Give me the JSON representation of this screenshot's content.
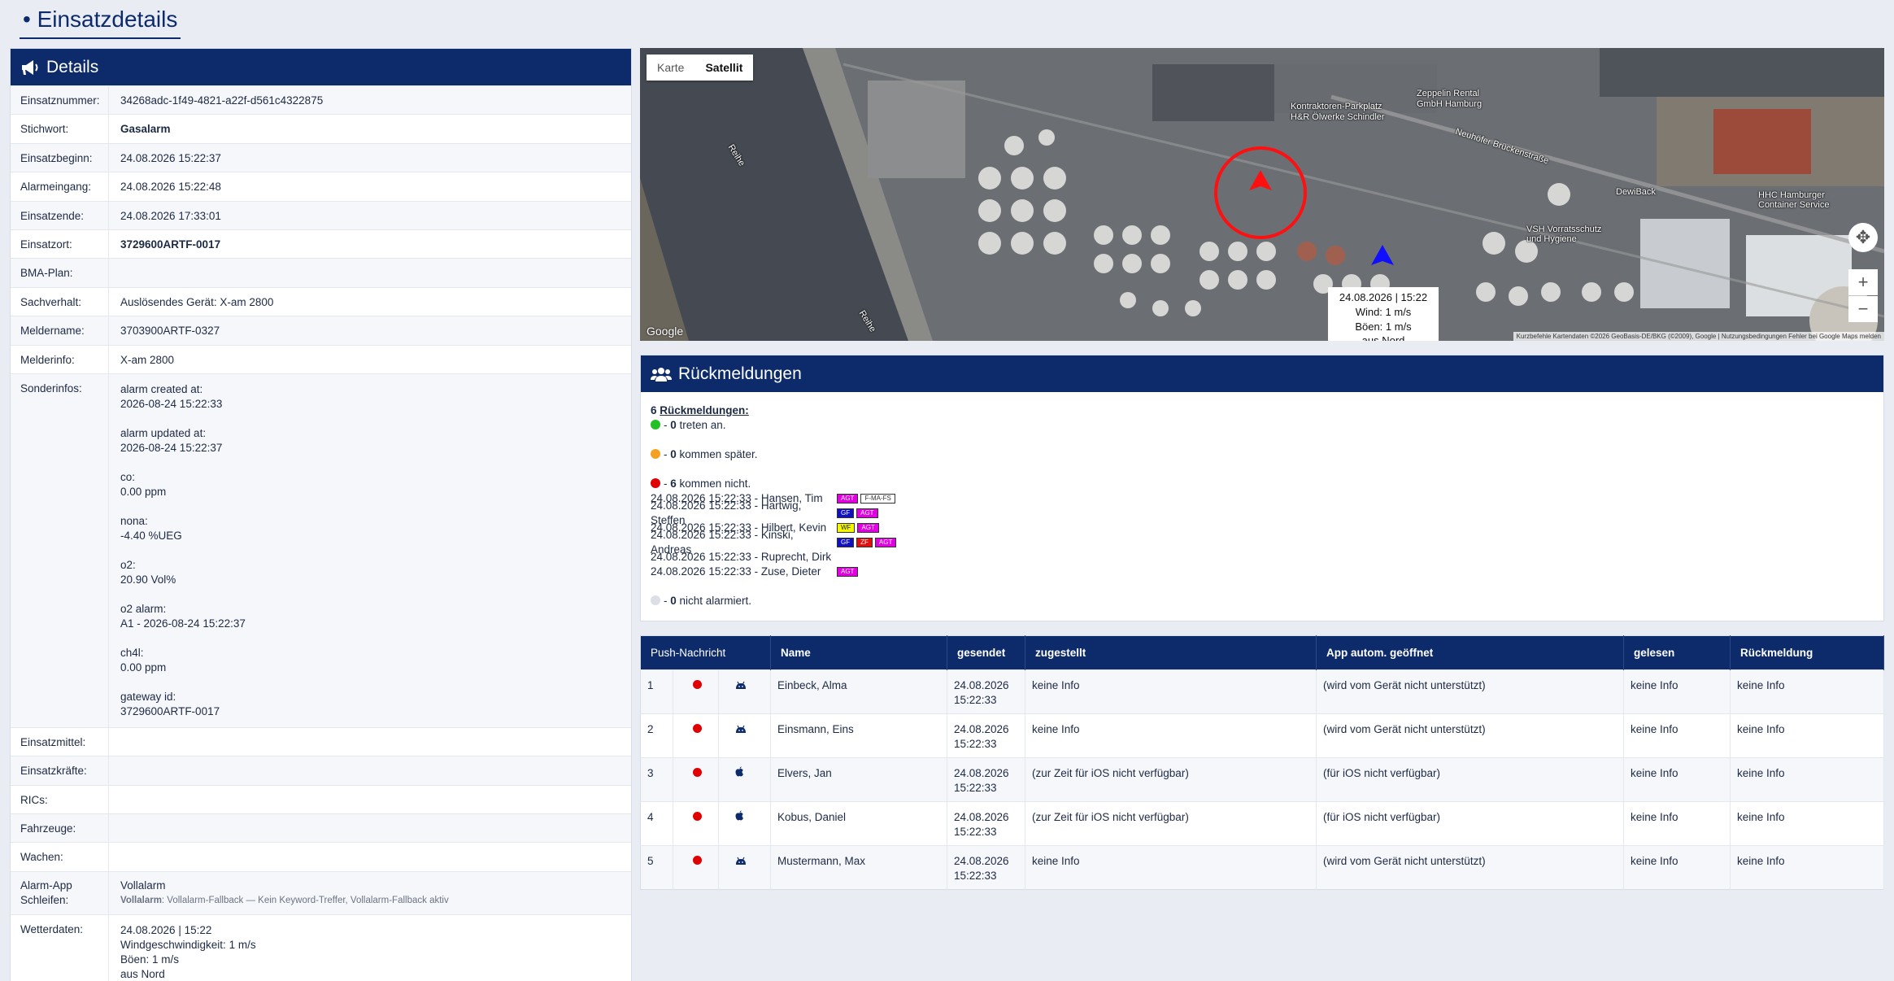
{
  "page": {
    "title": "• Einsatzdetails"
  },
  "details": {
    "header": "Details",
    "rows": [
      {
        "label": "Einsatznummer:",
        "value": "34268adc-1f49-4821-a22f-d561c4322875"
      },
      {
        "label": "Stichwort:",
        "value": "Gasalarm"
      },
      {
        "label": "Einsatzbeginn:",
        "value": "24.08.2026 15:22:37"
      },
      {
        "label": "Alarmeingang:",
        "value": "24.08.2026 15:22:48"
      },
      {
        "label": "Einsatzende:",
        "value": "24.08.2026 17:33:01"
      },
      {
        "label": "Einsatzort:",
        "value": "3729600ARTF-0017"
      },
      {
        "label": "BMA-Plan:",
        "value": ""
      },
      {
        "label": "Sachverhalt:",
        "value": "Auslösendes Gerät: X-am 2800"
      },
      {
        "label": "Meldername:",
        "value": "3703900ARTF-0327"
      },
      {
        "label": "Melderinfo:",
        "value": "X-am 2800"
      }
    ],
    "sonder": {
      "label": "Sonderinfos:",
      "lines": [
        "alarm created at:",
        "2026-08-24 15:22:33",
        "",
        "alarm updated at:",
        "2026-08-24 15:22:37",
        "",
        "co:",
        "0.00 ppm",
        "",
        "nona:",
        "-4.40 %UEG",
        "",
        "o2:",
        "20.90 Vol%",
        "",
        "o2 alarm:",
        "A1 - 2026-08-24 15:22:37",
        "",
        "ch4l:",
        "0.00 ppm",
        "",
        "gateway id:",
        "3729600ARTF-0017"
      ]
    },
    "rows2": [
      {
        "label": "Einsatzmittel:",
        "value": ""
      },
      {
        "label": "Einsatzkräfte:",
        "value": ""
      },
      {
        "label": "RICs:",
        "value": ""
      },
      {
        "label": "Fahrzeuge:",
        "value": ""
      },
      {
        "label": "Wachen:",
        "value": ""
      }
    ],
    "schleifen": {
      "label_1": "Alarm-App",
      "label_2": "Schleifen:",
      "value": "Vollalarm",
      "sub_bold": "Vollalarm",
      "sub_text": ": Vollalarm-Fallback — Kein Keyword-Treffer, Vollalarm-Fallback aktiv"
    },
    "wetter": {
      "label": "Wetterdaten:",
      "lines": [
        "24.08.2026 | 15:22",
        "Windgeschwindigkeit: 1 m/s",
        "Böen: 1 m/s",
        "aus Nord"
      ]
    }
  },
  "map": {
    "toggle_map": "Karte",
    "toggle_sat": "Satellit",
    "tooltip": [
      "24.08.2026 | 15:22",
      "Wind: 1 m/s",
      "Böen: 1 m/s",
      "aus Nord"
    ],
    "google": "Google",
    "footer": "Kurzbefehle   Kartendaten ©2026 GeoBasis-DE/BKG (©2009), Google | Nutzungsbedingungen   Fehler bei Google Maps melden",
    "labels": {
      "reihe_1": "Reihe",
      "reihe_2": "Reihe",
      "parkplatz_1": "Kontraktoren-Parkplatz",
      "parkplatz_2": "H&R Ölwerke Schindler",
      "zeppelin_1": "Zeppelin Rental",
      "zeppelin_2": "GmbH Hamburg",
      "strasse": "Neuhöfer Brückenstraße",
      "dewiback": "DewiBack",
      "hhc_1": "HHC Hamburger",
      "hhc_2": "Container Service",
      "vorrat_1": "VSH Vorratsschutz",
      "vorrat_2": "und Hygiene"
    },
    "zoom_in": "+",
    "zoom_out": "−"
  },
  "rueckmeldungen": {
    "header": "Rückmeldungen",
    "count": "6",
    "count_label": "Rückmeldungen:",
    "treten_count": "0",
    "treten_text": " treten an.",
    "spaeter_count": "0",
    "spaeter_text": " kommen später.",
    "nicht_count": "6",
    "nicht_text": " kommen nicht.",
    "entries": [
      {
        "text": "24.08.2026 15:22:33 - Hansen, Tim",
        "tags": [
          [
            "AGT",
            "#e000e0",
            "#fff"
          ],
          [
            "F-MA-FS",
            "#fff",
            "#333"
          ]
        ]
      },
      {
        "text": "24.08.2026 15:22:33 - Hartwig, Steffen",
        "tags": [
          [
            "GF",
            "#1010c0",
            "#fff"
          ],
          [
            "AGT",
            "#e000e0",
            "#fff"
          ]
        ]
      },
      {
        "text": "24.08.2026 15:22:33 - Hilbert, Kevin",
        "tags": [
          [
            "WF",
            "#f5f500",
            "#222"
          ],
          [
            "AGT",
            "#e000e0",
            "#fff"
          ]
        ]
      },
      {
        "text": "24.08.2026 15:22:33 - Kinski, Andreas",
        "tags": [
          [
            "GF",
            "#1010c0",
            "#fff"
          ],
          [
            "ZF",
            "#e01010",
            "#fff"
          ],
          [
            "AGT",
            "#e000e0",
            "#fff"
          ]
        ]
      },
      {
        "text": "24.08.2026 15:22:33 - Ruprecht, Dirk",
        "tags": []
      },
      {
        "text": "24.08.2026 15:22:33 - Zuse, Dieter",
        "tags": [
          [
            "AGT",
            "#e000e0",
            "#fff"
          ]
        ]
      }
    ],
    "nicht_alarmiert_count": "0",
    "nicht_alarmiert_text": " nicht alarmiert.",
    "colors": {
      "green": "#22c022",
      "orange": "#f5a020",
      "red": "#e00000",
      "grey": "#dcdfe5"
    }
  },
  "push_table": {
    "headers": [
      "Push-Nachricht",
      "Name",
      "gesendet",
      "zugestellt",
      "App autom. geöffnet",
      "gelesen",
      "Rückmeldung"
    ],
    "rows": [
      {
        "nr": "1",
        "os": "android-icon",
        "name": "Einbeck, Alma",
        "sent_1": "24.08.2026",
        "sent_2": "15:22:33",
        "delivered": "keine Info",
        "opened": "(wird vom Gerät nicht unterstützt)",
        "read": "keine Info",
        "reply": "keine Info"
      },
      {
        "nr": "2",
        "os": "android-icon",
        "name": "Einsmann, Eins",
        "sent_1": "24.08.2026",
        "sent_2": "15:22:33",
        "delivered": "keine Info",
        "opened": "(wird vom Gerät nicht unterstützt)",
        "read": "keine Info",
        "reply": "keine Info"
      },
      {
        "nr": "3",
        "os": "apple-icon",
        "name": "Elvers, Jan",
        "sent_1": "24.08.2026",
        "sent_2": "15:22:33",
        "delivered": "(zur Zeit für iOS nicht verfügbar)",
        "opened": "(für iOS nicht verfügbar)",
        "read": "keine Info",
        "reply": "keine Info"
      },
      {
        "nr": "4",
        "os": "apple-icon",
        "name": "Kobus, Daniel",
        "sent_1": "24.08.2026",
        "sent_2": "15:22:33",
        "delivered": "(zur Zeit für iOS nicht verfügbar)",
        "opened": "(für iOS nicht verfügbar)",
        "read": "keine Info",
        "reply": "keine Info"
      },
      {
        "nr": "5",
        "os": "android-icon",
        "name": "Mustermann, Max",
        "sent_1": "24.08.2026",
        "sent_2": "15:22:33",
        "delivered": "keine Info",
        "opened": "(wird vom Gerät nicht unterstützt)",
        "read": "keine Info",
        "reply": "keine Info"
      }
    ]
  }
}
